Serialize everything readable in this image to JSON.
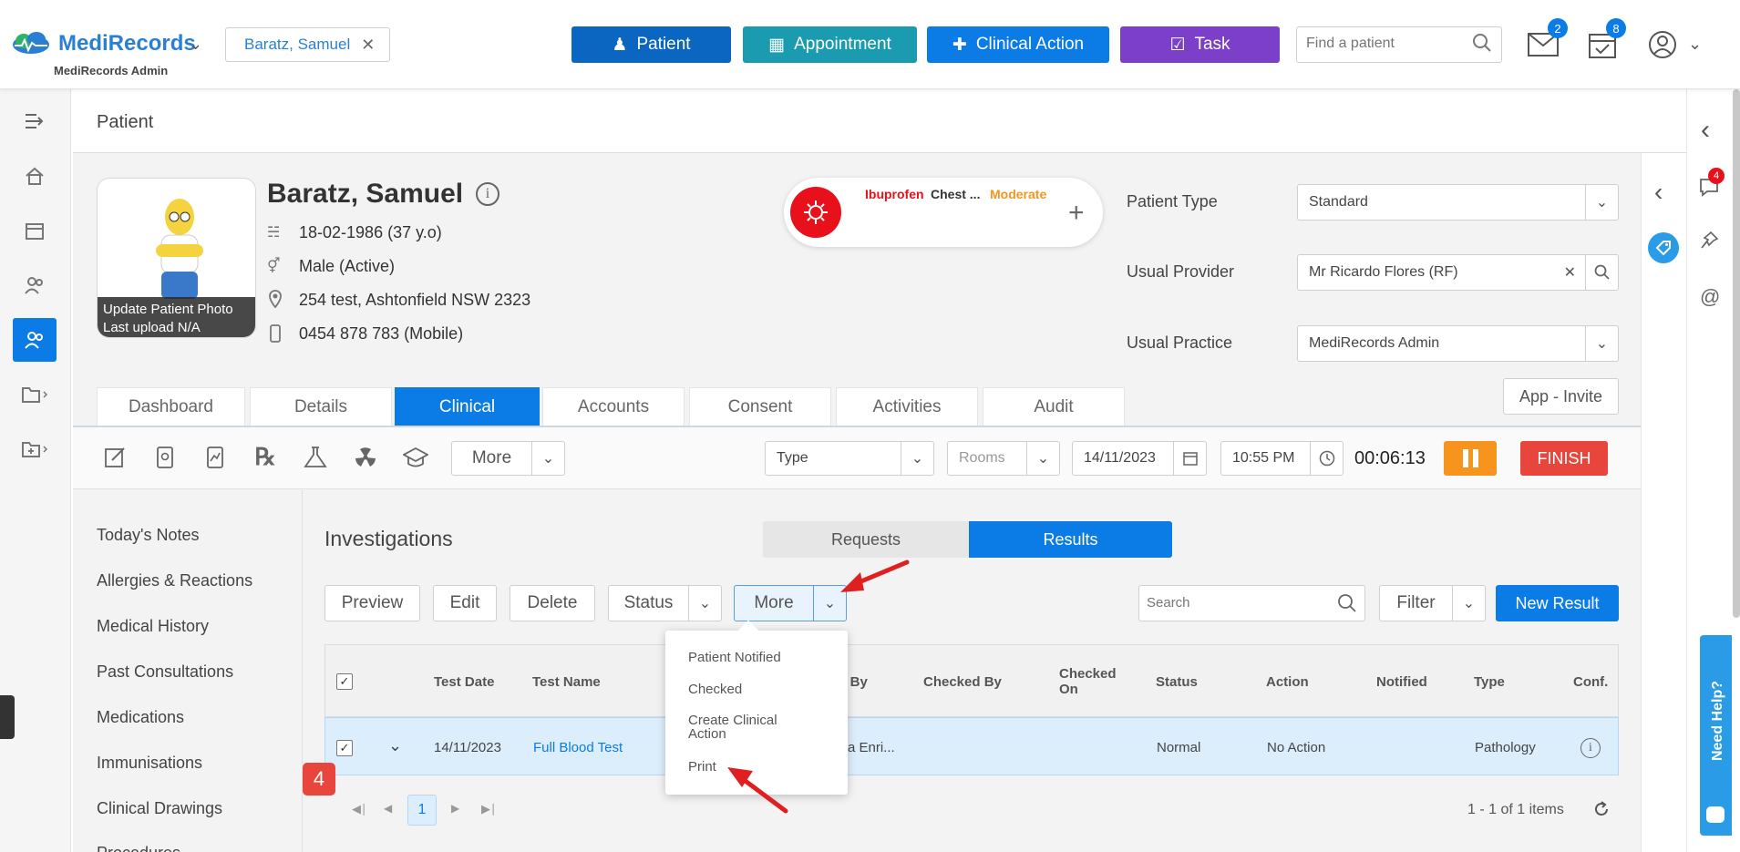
{
  "header": {
    "brand": "MediRecords",
    "brand_sub": "MediRecords Admin",
    "patient_tab": "Baratz, Samuel",
    "btn_patient": "Patient",
    "btn_appointment": "Appointment",
    "btn_clinical_action": "Clinical Action",
    "btn_task": "Task",
    "search_placeholder": "Find a patient",
    "mail_count": "2",
    "tasks_count": "8"
  },
  "page": {
    "title": "Patient"
  },
  "patient": {
    "name": "Baratz, Samuel",
    "dob": "18-02-1986 (37 y.o)",
    "gender": "Male (Active)",
    "address": "254 test, Ashtonfield NSW 2323",
    "phone": "0454 878 783 (Mobile)",
    "photo_line1": "Update Patient Photo",
    "photo_line2": "Last upload N/A"
  },
  "allergy": {
    "drug": "Ibuprofen",
    "reaction": "Chest ...",
    "severity": "Moderate"
  },
  "info": {
    "type_label": "Patient Type",
    "type_value": "Standard",
    "provider_label": "Usual Provider",
    "provider_value": "Mr Ricardo Flores (RF)",
    "practice_label": "Usual Practice",
    "practice_value": "MediRecords Admin",
    "app_invite": "App - Invite"
  },
  "tabs": [
    "Dashboard",
    "Details",
    "Clinical",
    "Accounts",
    "Consent",
    "Activities",
    "Audit"
  ],
  "toolbar": {
    "more": "More",
    "type": "Type",
    "rooms": "Rooms",
    "date": "14/11/2023",
    "time": "10:55 PM",
    "timer": "00:06:13",
    "finish": "FINISH"
  },
  "left_nav": [
    "Today's Notes",
    "Allergies & Reactions",
    "Medical History",
    "Past Consultations",
    "Medications",
    "Immunisations",
    "Clinical Drawings",
    "Procedures"
  ],
  "investigations": {
    "title": "Investigations",
    "requests": "Requests",
    "results": "Results",
    "preview": "Preview",
    "edit": "Edit",
    "delete": "Delete",
    "status": "Status",
    "more": "More",
    "search_placeholder": "Search",
    "filter": "Filter",
    "new_result": "New Result"
  },
  "table": {
    "headers": [
      "Test Date",
      "Test Name",
      "ed By",
      "Checked By",
      "Checked On",
      "Status",
      "Action",
      "Notified",
      "Type",
      "Conf."
    ],
    "row": {
      "date": "14/11/2023",
      "name": "Full Blood Test",
      "by": "a Enri...",
      "status": "Normal",
      "action": "No Action",
      "type": "Pathology"
    },
    "page": "1",
    "summary": "1 - 1 of 1 items"
  },
  "dropdown": [
    "Patient Notified",
    "Checked",
    "Create Clinical Action",
    "Print"
  ],
  "step_badge": "4",
  "help": "Need Help?",
  "rail_badge": "4",
  "colors": {
    "blue": "#0b7ce6",
    "teal": "#1a9bb0",
    "purple": "#7b3fc9",
    "orange": "#f7941d",
    "red": "#e8453c",
    "highlight": "#dceefc"
  }
}
